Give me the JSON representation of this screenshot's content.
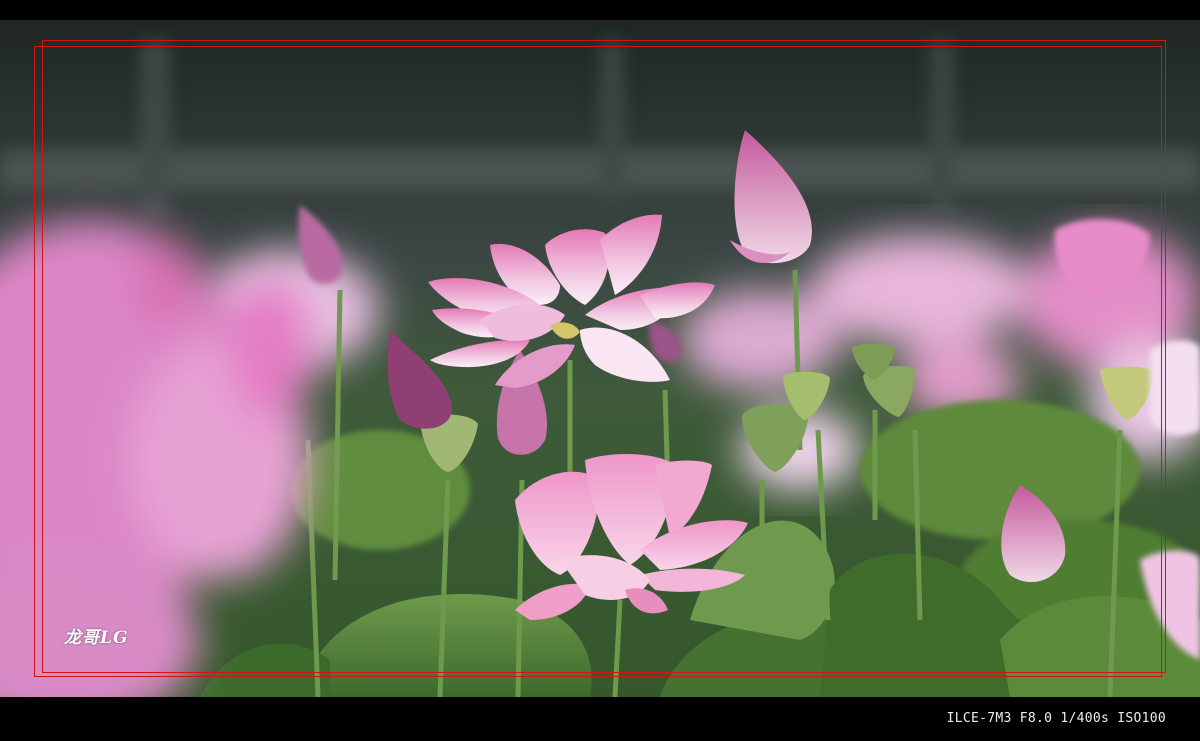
{
  "photo": {
    "subject": "lotus-pond",
    "colors": {
      "background_dark": "#2a3230",
      "petal_pink": "#e887c4",
      "petal_light": "#f6dff0",
      "leaf_green": "#4d7a34",
      "frame_red": "#d21414"
    }
  },
  "watermark": {
    "text": "龙哥LG"
  },
  "exif": {
    "text": "ILCE-7M3 F8.0 1/400s ISO100"
  }
}
